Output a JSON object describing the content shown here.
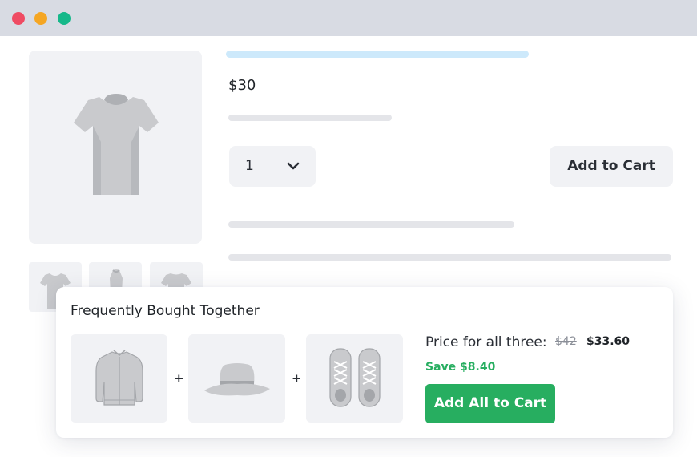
{
  "window": {
    "controls": [
      "close-dot",
      "minimize-dot",
      "maximize-dot"
    ],
    "colors": {
      "close": "#ef4b63",
      "minimize": "#f5a623",
      "maximize": "#16b88a"
    }
  },
  "product": {
    "image_icon": "tshirt-icon",
    "thumbnails": [
      "tshirt-front-icon",
      "tshirt-side-icon",
      "tshirt-back-icon"
    ],
    "price": "$30",
    "quantity": "1",
    "add_to_cart_label": "Add to Cart"
  },
  "bundle": {
    "title": "Frequently Bought Together",
    "items": [
      "jacket-icon",
      "hat-icon",
      "sneakers-icon"
    ],
    "plus": "+",
    "price_label": "Price for all three:",
    "old_price": "$42",
    "new_price": "$33.60",
    "savings": "Save $8.40",
    "add_all_label": "Add All to Cart"
  },
  "colors": {
    "accent_green": "#27ae60",
    "title_placeholder": "#cde9fb",
    "surface": "#f1f2f5"
  }
}
